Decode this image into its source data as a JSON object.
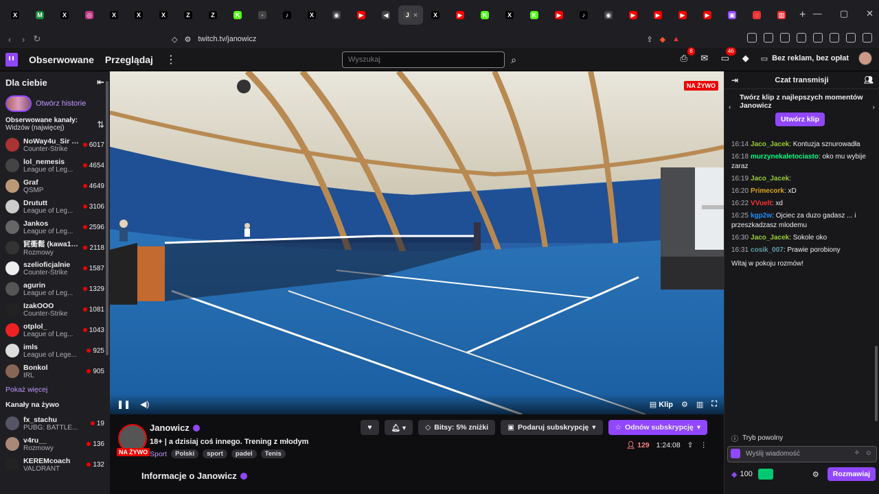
{
  "browser": {
    "tabs": [
      {
        "icon": "X",
        "color": "#000000"
      },
      {
        "icon": "M",
        "color": "#1a8a3a"
      },
      {
        "icon": "X",
        "color": "#000000"
      },
      {
        "icon": "◎",
        "color": "#c13584"
      },
      {
        "icon": "X",
        "color": "#000000"
      },
      {
        "icon": "X",
        "color": "#000000"
      },
      {
        "icon": "X",
        "color": "#000000"
      },
      {
        "icon": "Z",
        "color": "#000000"
      },
      {
        "icon": "Z",
        "color": "#000000"
      },
      {
        "icon": "K",
        "color": "#53fc18"
      },
      {
        "icon": "◦",
        "color": "#444"
      },
      {
        "icon": "♪",
        "color": "#000000"
      },
      {
        "icon": "X",
        "color": "#000000"
      },
      {
        "icon": "◉",
        "color": "#444"
      },
      {
        "icon": "▶",
        "color": "#ff0000"
      },
      {
        "icon": "◀",
        "color": "#444"
      },
      {
        "icon": "J",
        "color": "#444"
      },
      {
        "icon": "X",
        "color": "#000000"
      },
      {
        "icon": "▶",
        "color": "#ff0000"
      },
      {
        "icon": "K",
        "color": "#53fc18"
      },
      {
        "icon": "X",
        "color": "#000000"
      },
      {
        "icon": "K",
        "color": "#53fc18"
      },
      {
        "icon": "▶",
        "color": "#ff0000"
      },
      {
        "icon": "♪",
        "color": "#000000"
      },
      {
        "icon": "◉",
        "color": "#444"
      },
      {
        "icon": "▶",
        "color": "#ff0000"
      },
      {
        "icon": "▶",
        "color": "#ff0000"
      },
      {
        "icon": "▶",
        "color": "#ff0000"
      },
      {
        "icon": "▶",
        "color": "#ff0000"
      },
      {
        "icon": "▣",
        "color": "#9147ff"
      },
      {
        "icon": "◌",
        "color": "#e33"
      },
      {
        "icon": "▥",
        "color": "#e33"
      }
    ],
    "url": "twitch.tv/janowicz"
  },
  "nav": {
    "following": "Obserwowane",
    "browse": "Przeglądaj",
    "search_placeholder": "Wyszukaj",
    "inbox_badge": "8",
    "notif_badge": "46",
    "prime": "Bez reklam, bez opłat"
  },
  "sidebar": {
    "for_you": "Dla ciebie",
    "stories": "Otwórz historie",
    "followed_label": "Obserwowane kanały:",
    "sort_label": "Widzów (najwięcej)",
    "channels": [
      {
        "name": "NoWay4u_Sir +2",
        "game": "Counter-Strike",
        "viewers": "6017",
        "color": "#a33"
      },
      {
        "name": "lol_nemesis",
        "game": "League of Leg...",
        "viewers": "4654",
        "color": "#444"
      },
      {
        "name": "Graf",
        "game": "QSMP",
        "viewers": "4649",
        "color": "#b97"
      },
      {
        "name": "Drututt",
        "game": "League of Leg...",
        "viewers": "3106",
        "color": "#ccc"
      },
      {
        "name": "Jankos",
        "game": "League of Leg...",
        "viewers": "2596",
        "color": "#666"
      },
      {
        "name": "㓃衝鬆 (kawa1s...",
        "game": "Rozmowy",
        "viewers": "2118",
        "color": "#333"
      },
      {
        "name": "szelioficjalnie",
        "game": "Counter-Strike",
        "viewers": "1587",
        "color": "#eee"
      },
      {
        "name": "agurin",
        "game": "League of Leg...",
        "viewers": "1329",
        "color": "#555"
      },
      {
        "name": "IzakOOO",
        "game": "Counter-Strike",
        "viewers": "1081",
        "color": "#222"
      },
      {
        "name": "otplol_",
        "game": "League of Leg...",
        "viewers": "1043",
        "color": "#e22"
      },
      {
        "name": "imls",
        "game": "League of Lege...",
        "viewers": "925",
        "color": "#ddd"
      },
      {
        "name": "Bonkol",
        "game": "IRL",
        "viewers": "905",
        "color": "#865"
      }
    ],
    "show_more": "Pokaż więcej",
    "live_channels": "Kanały na żywo",
    "live": [
      {
        "name": "fx_stachu",
        "game": "PUBG: BATTLE...",
        "viewers": "19",
        "color": "#556"
      },
      {
        "name": "v4ru__",
        "game": "Rozmowy",
        "viewers": "136",
        "color": "#a87"
      },
      {
        "name": "KEREMcoach",
        "game": "VALORANT",
        "viewers": "132",
        "color": "#222"
      }
    ]
  },
  "player": {
    "live_tag": "NA ŻYWO",
    "clip": "Klip"
  },
  "stream": {
    "channel": "Janowicz",
    "live": "NA ŻYWO",
    "title": "18+ | a dzisiaj coś innego. Trening z młodym",
    "category": "Sport",
    "tags": [
      "Polski",
      "sport",
      "padel",
      "Tenis"
    ],
    "bits": "Bitsy: 5% zniżki",
    "gift": "Podaruj subskrypcję",
    "resub": "Odnów subskrypcję",
    "viewers": "129",
    "uptime": "1:24:08",
    "about": "Informacje o Janowicz"
  },
  "chat": {
    "title": "Czat transmisji",
    "promo": "Twórz klip z najlepszych momentów Janowicz",
    "clip_btn": "Utwórz klip",
    "messages": [
      {
        "t": "16:14",
        "u": "Jaco_Jacek",
        "c": "#9acd32",
        "m": ": Kontuzja sznurowadła"
      },
      {
        "t": "16:18",
        "u": "murzynekaletociasto",
        "c": "#00ff7f",
        "m": ": oko mu wybije zaraz"
      },
      {
        "t": "16:19",
        "u": "Jaco_Jacek",
        "c": "#9acd32",
        "m": ":"
      },
      {
        "t": "16:20",
        "u": "Primecork",
        "c": "#daa520",
        "m": ": xD"
      },
      {
        "t": "16:22",
        "u": "VVuelt",
        "c": "#ff3030",
        "m": ": xd"
      },
      {
        "t": "16:25",
        "u": "kgp2w",
        "c": "#1e90ff",
        "m": ": Ojciec za duzo gadasz ... i przeszkadzasz mlodemu"
      },
      {
        "t": "16:30",
        "u": "Jaco_Jacek",
        "c": "#9acd32",
        "m": ": Sokole oko"
      },
      {
        "t": "16:31",
        "u": "cosik_007",
        "c": "#5f9ea0",
        "m": ": Prawie porobiony"
      }
    ],
    "welcome": "Witaj w pokoju rozmów!",
    "slow_mode": "Tryb powolny",
    "input_placeholder": "Wyślij wiadomość",
    "points": "100",
    "send": "Rozmawiaj"
  },
  "colors": {
    "accent": "#9147ff",
    "live": "#eb0400",
    "bg": "#0e0e10"
  }
}
